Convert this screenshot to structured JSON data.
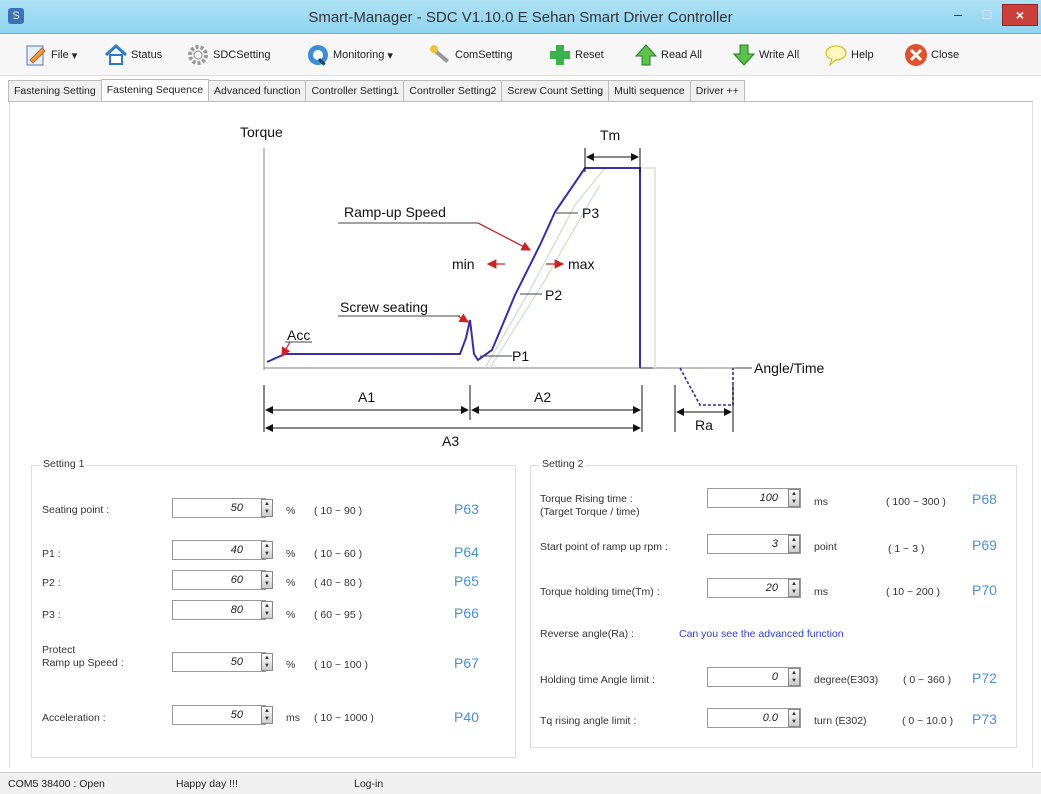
{
  "window": {
    "title": "Smart-Manager - SDC  V1.10.0 E  Sehan Smart Driver Controller"
  },
  "toolbar": {
    "file": "File",
    "status": "Status",
    "sdcsetting": "SDCSetting",
    "monitoring": "Monitoring",
    "comsetting": "ComSetting",
    "reset": "Reset",
    "readall": "Read All",
    "writeall": "Write All",
    "help": "Help",
    "close": "Close"
  },
  "tabs": [
    "Fastening Setting",
    "Fastening Sequence",
    "Advanced function",
    "Controller Setting1",
    "Controller Setting2",
    "Screw Count Setting",
    "Multi sequence",
    "Driver ++"
  ],
  "diagram": {
    "torque": "Torque",
    "tm": "Tm",
    "ramp_up": "Ramp-up  Speed",
    "p3": "P3",
    "min": "min",
    "max": "max",
    "p2": "P2",
    "screw_seating": "Screw  seating",
    "acc": "Acc",
    "p1": "P1",
    "angle_time": "Angle/Time",
    "a1": "A1",
    "a2": "A2",
    "a3": "A3",
    "ra": "Ra"
  },
  "setting1": {
    "title": "Setting 1",
    "rows": [
      {
        "label": "Seating point :",
        "value": "50",
        "unit": "%",
        "range": "( 10 ~ 90 )",
        "code": "P63"
      },
      {
        "label": "P1 :",
        "value": "40",
        "unit": "%",
        "range": "( 10 ~ 60 )",
        "code": "P64"
      },
      {
        "label": "P2 :",
        "value": "60",
        "unit": "%",
        "range": "( 40 ~ 80 )",
        "code": "P65"
      },
      {
        "label": "P3 :",
        "value": "80",
        "unit": "%",
        "range": "( 60 ~ 95 )",
        "code": "P66"
      },
      {
        "label": "Protect",
        "label2": "Ramp up Speed :",
        "value": "50",
        "unit": "%",
        "range": "( 10 ~ 100 )",
        "code": "P67"
      },
      {
        "label": "Acceleration :",
        "value": "50",
        "unit": "ms",
        "range": "( 10 ~ 1000 )",
        "code": "P40"
      }
    ]
  },
  "setting2": {
    "title": "Setting 2",
    "rows": [
      {
        "label": "Torque Rising time :",
        "label2": "(Target Torque / time)",
        "value": "100",
        "unit": "ms",
        "range": "( 100 ~ 300 )",
        "code": "P68"
      },
      {
        "label": "Start point of ramp up rpm :",
        "value": "3",
        "unit": "point",
        "range": "( 1 ~ 3 )",
        "code": "P69"
      },
      {
        "label": "Torque holding time(Tm) :",
        "value": "20",
        "unit": "ms",
        "range": "( 10 ~ 200 )",
        "code": "P70"
      },
      {
        "label": "Holding time Angle limit :",
        "value": "0",
        "unit": "degree(E303)",
        "range": "( 0 ~ 360 )",
        "code": "P72"
      },
      {
        "label": "Tq rising angle limit :",
        "value": "0.0",
        "unit": "turn (E302)",
        "range": "( 0 ~ 10.0 )",
        "code": "P73"
      }
    ],
    "reverse_label": "Reverse angle(Ra) :",
    "reverse_link": "Can you see the advanced function"
  },
  "status": {
    "port": "COM5  38400 : Open",
    "message": "Happy day !!!",
    "login": "Log-in"
  },
  "colors": {
    "curve": "#3a2ea8",
    "pcode": "#4a8fd8",
    "link": "#2b3fd1",
    "arrow_red": "#cc2222"
  }
}
